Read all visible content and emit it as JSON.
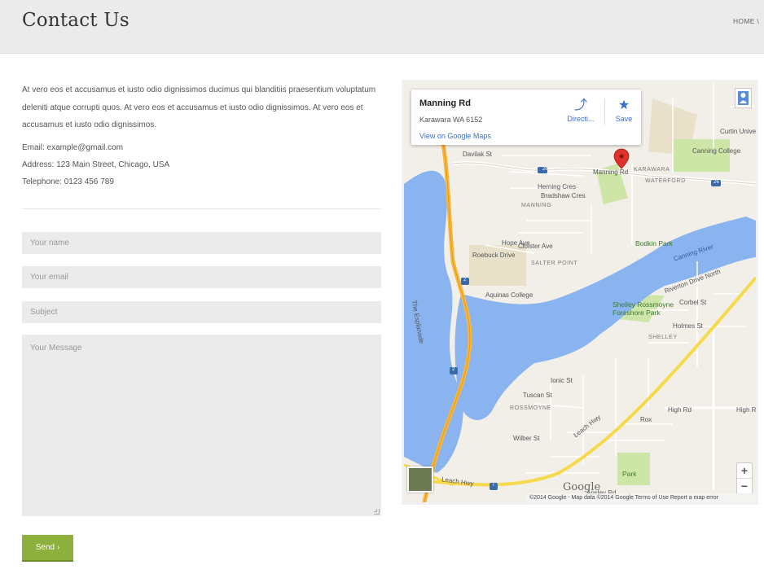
{
  "header": {
    "title": "Contact Us",
    "breadcrumb": "HOME \\"
  },
  "content": {
    "intro": "At vero eos et accusamus et iusto odio dignissimos ducimus qui blanditiis praesentium voluptatum deleniti atque corrupti quos. At vero eos et accusamus et iusto odio dignissimos. At vero eos et accusamus et iusto odio dignissimos.",
    "email": "Email: example@gmail.com",
    "address": "Address: 123 Main Street, Chicago, USA",
    "telephone": "Telephone: 0123 456 789"
  },
  "form": {
    "name_placeholder": "Your name",
    "email_placeholder": "Your email",
    "subject_placeholder": "Subject",
    "message_placeholder": "Your Message",
    "send_label": "Send ›"
  },
  "map": {
    "info": {
      "title": "Manning Rd",
      "address": "Karawara WA 6152",
      "link": "View on Google Maps",
      "directions": "Directi...",
      "save": "Save"
    },
    "labels": {
      "davilak": "Davilak St",
      "manning_rd": "Manning Rd",
      "karawara": "KARAWARA",
      "waterford": "WATERFORD",
      "herning": "Herning Cres",
      "bradshaw": "Bradshaw Cres",
      "manning": "MANNING",
      "cloister": "Cloister Ave",
      "hope": "Hope Ave",
      "roebuck": "Roebuck Drive",
      "salter": "SALTER POINT",
      "aquinas": "Aquinas College",
      "bodkin": "Bodkin Park",
      "canning_river": "Canning River",
      "riverton": "Riverton Drive North",
      "shelley_park": "Shelley Rossmoyne Foreshore Park",
      "corbel": "Corbel St",
      "holmes": "Holmes St",
      "shelley": "SHELLEY",
      "curtin": "Curtin Univer",
      "canning_college": "Canning College",
      "ionic": "Ionic St",
      "tuscan": "Tuscan St",
      "rossmoyne": "ROSSMOYNE",
      "wilber": "Wilber St",
      "high": "High Rd",
      "high2": "High R",
      "rox": "Rox",
      "leach": "Leach Hwy",
      "leach2": "Leach Hwy",
      "park": "Park",
      "apsley": "Apsley Rd",
      "esplanade": "The Esplanade",
      "google": "Google"
    },
    "route_shields": [
      "26",
      "26",
      "2",
      "2",
      "7"
    ],
    "attribution": "©2014 Google - Map data ©2014 Google   Terms of Use   Report a map error",
    "colors": {
      "water": "#8ab4f0",
      "land": "#f2efe9",
      "park": "#cde6a8",
      "highway": "#f7b73c",
      "major_road": "#ffffff",
      "marker": "#e0312b"
    }
  }
}
